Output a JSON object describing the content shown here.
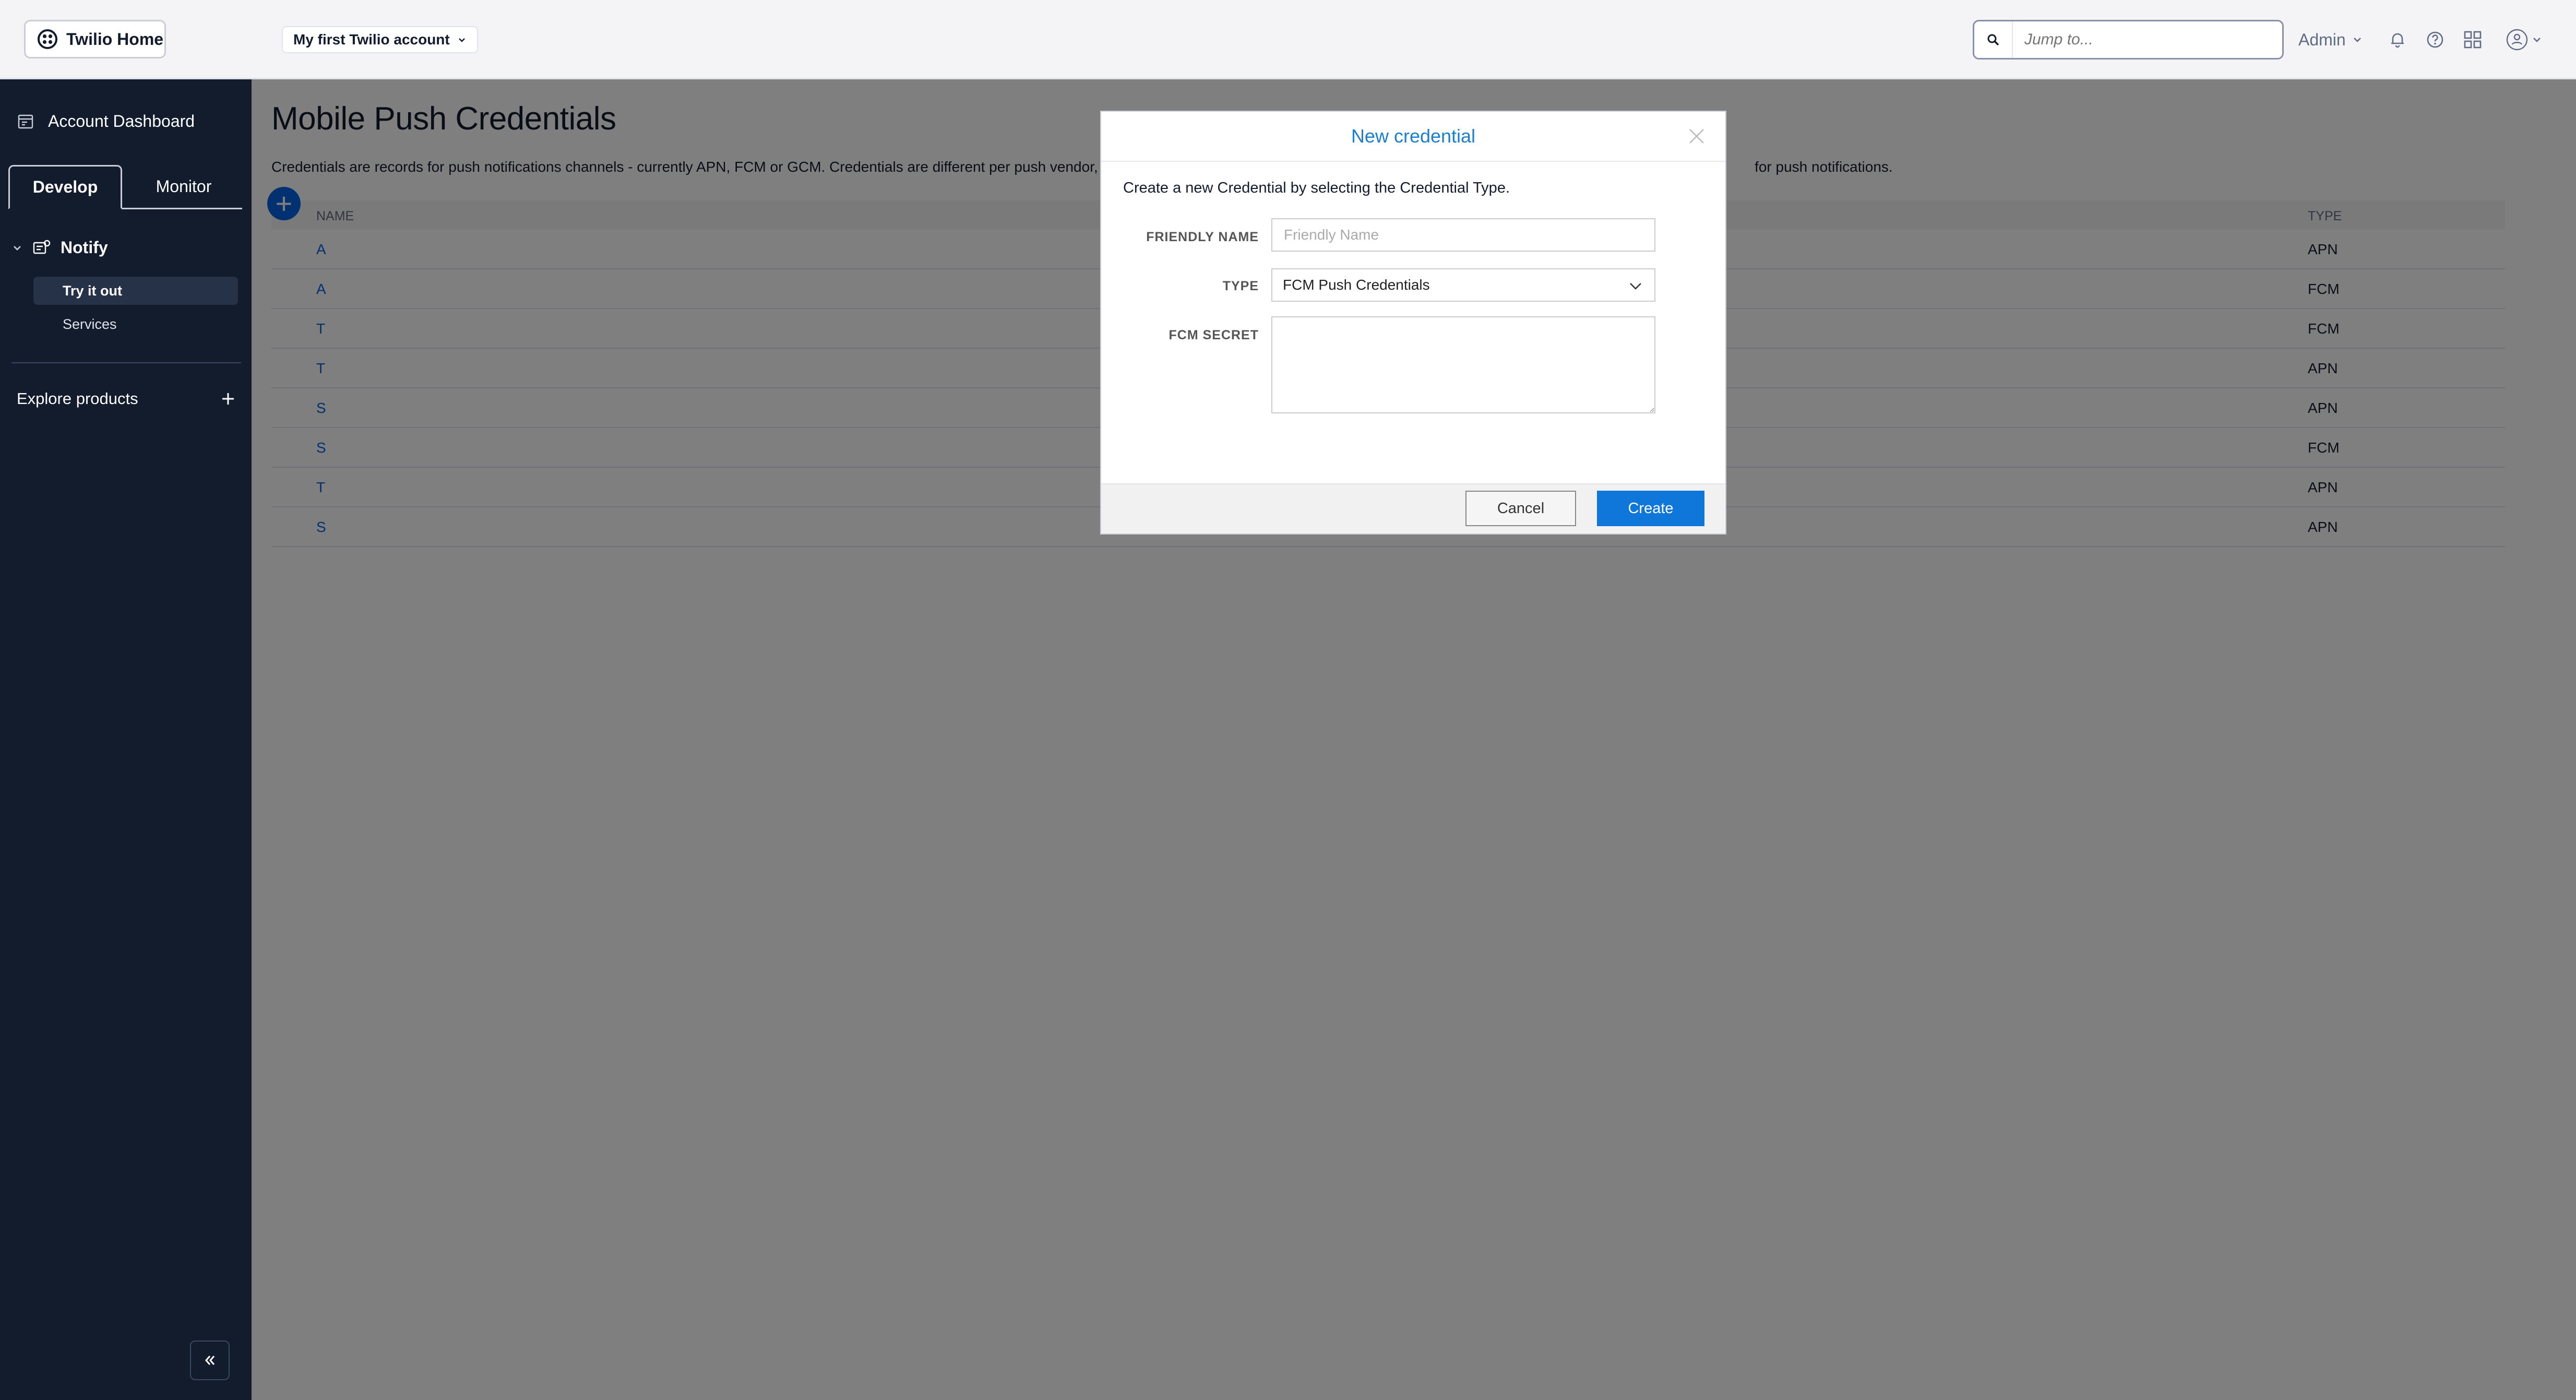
{
  "header": {
    "home_label": "Twilio Home",
    "account_label": "My first Twilio account",
    "search_placeholder": "Jump to...",
    "admin_label": "Admin"
  },
  "sidebar": {
    "dashboard_label": "Account Dashboard",
    "tabs": [
      {
        "label": "Develop",
        "active": true
      },
      {
        "label": "Monitor",
        "active": false
      }
    ],
    "section_label": "Notify",
    "items": [
      {
        "label": "Try it out",
        "active": true
      },
      {
        "label": "Services",
        "active": false
      }
    ],
    "explore_label": "Explore products"
  },
  "main": {
    "title": "Mobile Push Credentials",
    "description_start": "Credentials are records for push notifications channels - currently APN, FCM or GCM. Credentials are different per push vendor, and are",
    "description_end": "for push notifications.",
    "columns": {
      "name": "NAME",
      "type": "TYPE"
    },
    "rows": [
      {
        "name": "A",
        "type": "APN"
      },
      {
        "name": "A",
        "type": "FCM"
      },
      {
        "name": "T",
        "type": "FCM"
      },
      {
        "name": "T",
        "type": "APN"
      },
      {
        "name": "S",
        "type": "APN"
      },
      {
        "name": "S",
        "type": "FCM"
      },
      {
        "name": "T",
        "type": "APN"
      },
      {
        "name": "S",
        "type": "APN"
      }
    ]
  },
  "modal": {
    "title": "New credential",
    "intro": "Create a new Credential by selecting the Credential Type.",
    "friendly_name_label": "FRIENDLY NAME",
    "friendly_name_placeholder": "Friendly Name",
    "friendly_name_value": "",
    "type_label": "TYPE",
    "type_value": "FCM Push Credentials",
    "secret_label": "FCM SECRET",
    "secret_value": "",
    "cancel_label": "Cancel",
    "create_label": "Create"
  },
  "colors": {
    "sidebar_bg": "#121c2d",
    "primary_button": "#0e77d9",
    "link": "#0263e0",
    "modal_title": "#1a7fd0"
  }
}
